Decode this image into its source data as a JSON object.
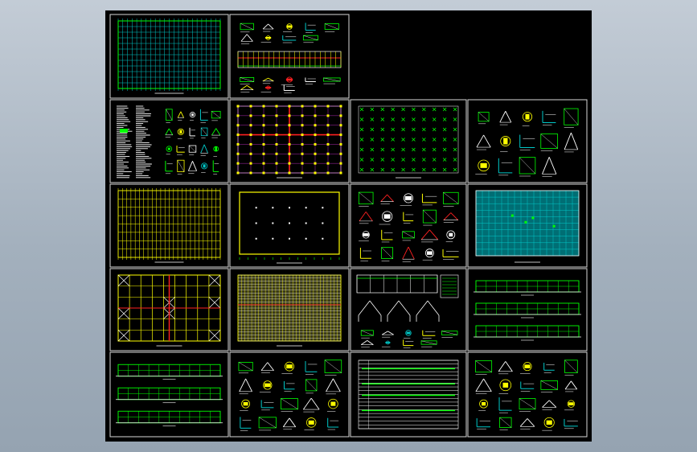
{
  "canvas": {
    "background_color": "#000000",
    "frame_color": "#d8d8d8"
  },
  "sheets": [
    {
      "id": "s01",
      "row": 0,
      "col": 0,
      "kind": "grid-plan",
      "theme": "cyan"
    },
    {
      "id": "s02",
      "row": 0,
      "col": 1,
      "kind": "detail-elevation",
      "theme": "mixed"
    },
    {
      "id": "s03",
      "row": 1,
      "col": 0,
      "kind": "notes-details",
      "theme": "mixed"
    },
    {
      "id": "s04",
      "row": 1,
      "col": 1,
      "kind": "foundation-plan",
      "theme": "red-yellow"
    },
    {
      "id": "s05",
      "row": 1,
      "col": 2,
      "kind": "dot-grid",
      "theme": "green"
    },
    {
      "id": "s06",
      "row": 1,
      "col": 3,
      "kind": "details",
      "theme": "mixed"
    },
    {
      "id": "s07",
      "row": 2,
      "col": 0,
      "kind": "column-grid",
      "theme": "yellow"
    },
    {
      "id": "s08",
      "row": 2,
      "col": 1,
      "kind": "outline-plan",
      "theme": "yellow"
    },
    {
      "id": "s09",
      "row": 2,
      "col": 2,
      "kind": "details",
      "theme": "mixed"
    },
    {
      "id": "s10",
      "row": 2,
      "col": 3,
      "kind": "roof-plan",
      "theme": "cyan"
    },
    {
      "id": "s11",
      "row": 3,
      "col": 0,
      "kind": "braced-frame",
      "theme": "yellow-red"
    },
    {
      "id": "s12",
      "row": 3,
      "col": 1,
      "kind": "dense-grid",
      "theme": "yellow"
    },
    {
      "id": "s13",
      "row": 3,
      "col": 2,
      "kind": "section-details",
      "theme": "mixed"
    },
    {
      "id": "s14",
      "row": 3,
      "col": 3,
      "kind": "elevations",
      "theme": "green"
    },
    {
      "id": "s15",
      "row": 4,
      "col": 0,
      "kind": "elevations",
      "theme": "green"
    },
    {
      "id": "s16",
      "row": 4,
      "col": 1,
      "kind": "details",
      "theme": "mixed"
    },
    {
      "id": "s17",
      "row": 4,
      "col": 2,
      "kind": "table",
      "theme": "white-green"
    },
    {
      "id": "s18",
      "row": 4,
      "col": 3,
      "kind": "details",
      "theme": "mixed"
    }
  ],
  "palette": {
    "cyan": "#00c8c8",
    "green": "#00ff00",
    "yellow": "#ffff00",
    "red": "#ff2020",
    "white": "#ffffff",
    "magenta": "#ff40ff",
    "blue": "#4060ff"
  }
}
